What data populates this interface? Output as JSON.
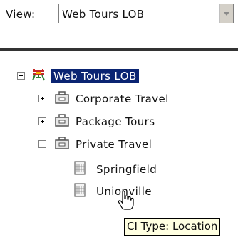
{
  "view": {
    "label": "View:",
    "selected": "Web Tours LOB"
  },
  "tree": {
    "root": {
      "label": "Web Tours LOB",
      "expanded": true,
      "selected": true,
      "icon": "business-service-icon"
    },
    "items": [
      {
        "label": "Corporate Travel",
        "expanded": false,
        "icon": "briefcase-icon"
      },
      {
        "label": "Package Tours",
        "expanded": false,
        "icon": "briefcase-icon"
      },
      {
        "label": "Private Travel",
        "expanded": true,
        "icon": "briefcase-icon"
      }
    ],
    "locations": [
      {
        "label": "Springfield",
        "icon": "building-icon"
      },
      {
        "label": "Unionville",
        "icon": "building-icon"
      }
    ]
  },
  "tooltip": {
    "text": "CI Type: Location"
  },
  "colors": {
    "selection": "#0a2472",
    "tooltip_bg": "#ffffe1"
  }
}
